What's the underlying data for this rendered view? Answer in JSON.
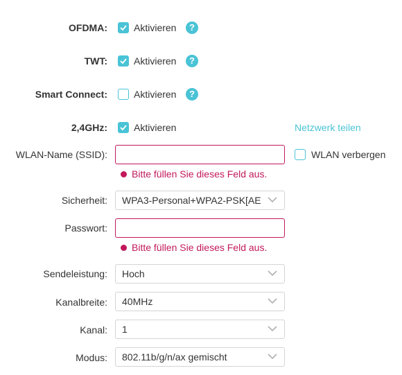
{
  "features": {
    "ofdma": {
      "label": "OFDMA:",
      "checkbox_label": "Aktivieren",
      "checked": true,
      "help": "?"
    },
    "twt": {
      "label": "TWT:",
      "checkbox_label": "Aktivieren",
      "checked": true,
      "help": "?"
    },
    "smart_connect": {
      "label": "Smart Connect:",
      "checkbox_label": "Aktivieren",
      "checked": false,
      "help": "?"
    }
  },
  "band_24": {
    "label": "2,4GHz:",
    "checkbox_label": "Aktivieren",
    "checked": true,
    "share_link": "Netzwerk teilen"
  },
  "ssid": {
    "label": "WLAN-Name (SSID):",
    "value": "",
    "error": "Bitte füllen Sie dieses Feld aus.",
    "hide_label": "WLAN verbergen",
    "hide_checked": false
  },
  "security": {
    "label": "Sicherheit:",
    "value": "WPA3-Personal+WPA2-PSK[AE"
  },
  "password": {
    "label": "Passwort:",
    "value": "",
    "error": "Bitte füllen Sie dieses Feld aus."
  },
  "tx_power": {
    "label": "Sendeleistung:",
    "value": "Hoch"
  },
  "channel_width": {
    "label": "Kanalbreite:",
    "value": "40MHz"
  },
  "channel": {
    "label": "Kanal:",
    "value": "1"
  },
  "mode": {
    "label": "Modus:",
    "value": "802.11b/g/n/ax gemischt"
  },
  "colors": {
    "accent": "#4ac3d6",
    "error": "#c2185b",
    "text": "#333333",
    "border": "#d4d4d4"
  },
  "icons": {
    "help": "question-circle-icon",
    "checkbox": "checkmark-icon",
    "dropdown": "chevron-down-icon"
  }
}
